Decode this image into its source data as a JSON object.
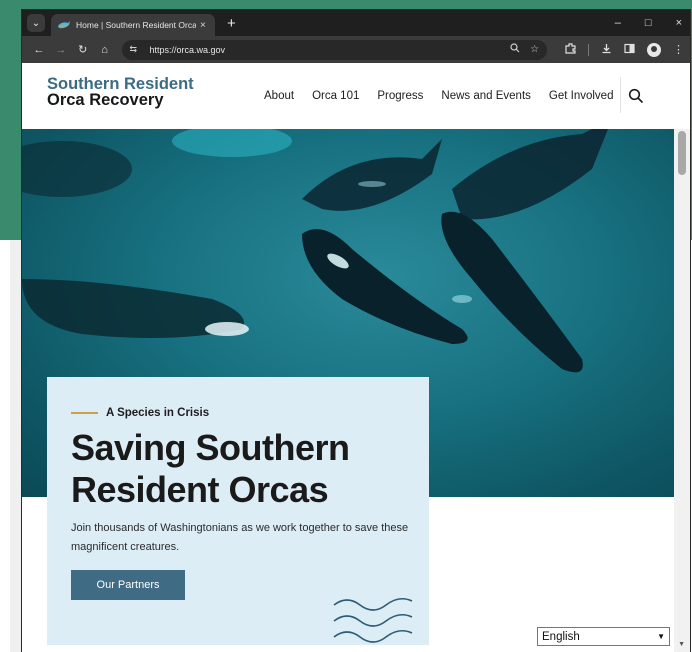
{
  "browser": {
    "tab": {
      "title": "Home | Southern Resident Orca",
      "close": "×"
    },
    "new_tab": "+",
    "window_controls": {
      "minimize": "–",
      "maximize": "□",
      "close": "×"
    },
    "toolbar": {
      "back": "←",
      "forward": "→",
      "reload": "↻",
      "home": "⌂",
      "site_info": "⇆"
    },
    "address": {
      "url": "https://orca.wa.gov"
    },
    "icons": [
      "zoom-icon",
      "bookmark-star-icon",
      "extensions-icon",
      "download-icon",
      "sidebar-icon",
      "profile-icon",
      "menu-icon"
    ]
  },
  "site": {
    "logo": {
      "line1": "Southern Resident",
      "line2": "Orca Recovery"
    },
    "nav": [
      {
        "label": "About"
      },
      {
        "label": "Orca 101"
      },
      {
        "label": "Progress"
      },
      {
        "label": "News and Events"
      },
      {
        "label": "Get Involved"
      }
    ],
    "hero": {
      "eyebrow": "A Species in Crisis",
      "title_line1": "Saving Southern",
      "title_line2": "Resident Orcas",
      "text": "Join thousands of Washingtonians as we work together to save these magnificent creatures.",
      "cta": "Our Partners"
    },
    "language_select": {
      "selected": "English"
    }
  },
  "colors": {
    "brand_blue": "#3c6b86",
    "button_blue": "#3f6b84",
    "card_bg": "#dcedf6",
    "accent_gold": "#c9a14a",
    "desktop_green": "#3a8a6e"
  }
}
